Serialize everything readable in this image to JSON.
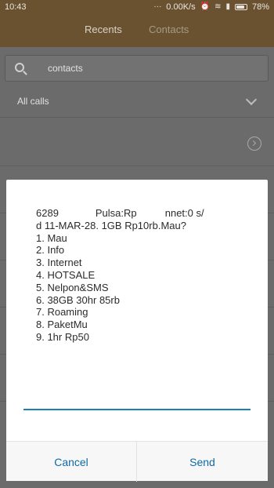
{
  "status_bar": {
    "time": "10:43",
    "speed": "0.00K/s",
    "battery": "78%",
    "icons": [
      "more-icon",
      "alarm-icon",
      "wifi-icon",
      "signal-icon",
      "battery-icon"
    ]
  },
  "tabs": {
    "recents": "Recents",
    "contacts": "Contacts"
  },
  "search": {
    "value": "contacts"
  },
  "filter": {
    "label": "All calls"
  },
  "dialog": {
    "message": "6289             Pulsa:Rp          nnet:0 s/\nd 11-MAR-28. 1GB Rp10rb.Mau?\n1. Mau\n2. Info\n3. Internet\n4. HOTSALE\n5. Nelpon&SMS\n6. 38GB 30hr 85rb\n7. Roaming\n8. PaketMu\n9. 1hr Rp50",
    "cancel_label": "Cancel",
    "send_label": "Send"
  },
  "colors": {
    "header": "#6a5231",
    "dim_background": "#6b6b6b",
    "accent": "#1e7fb0",
    "button_text": "#0f6aa3"
  }
}
